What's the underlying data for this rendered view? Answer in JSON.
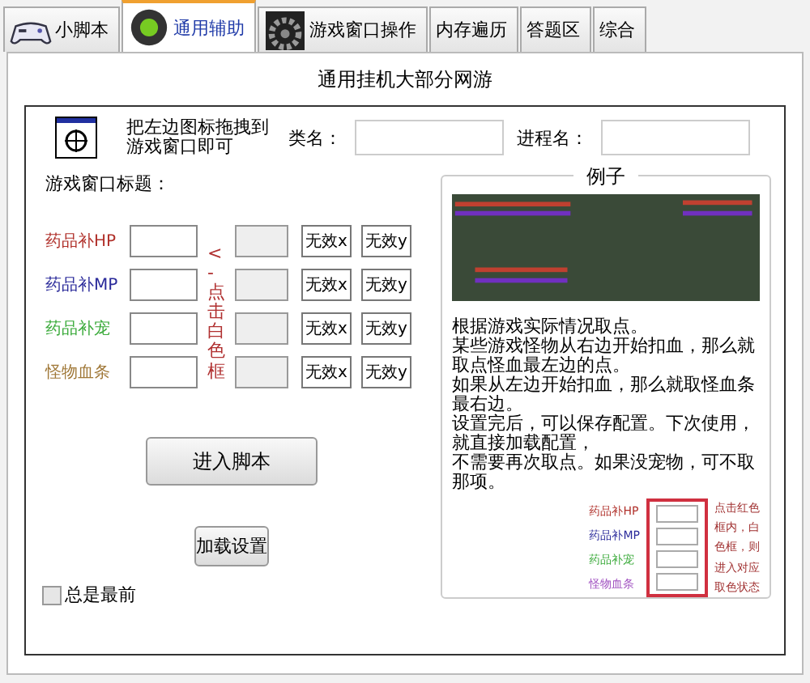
{
  "tabs": [
    {
      "label": "小脚本",
      "kind": "gamepad",
      "selected": false
    },
    {
      "label": "通用辅助",
      "kind": "orb",
      "selected": true
    },
    {
      "label": "游戏窗口操作",
      "kind": "gear",
      "selected": false
    },
    {
      "label": "内存遍历",
      "kind": "plain",
      "selected": false
    },
    {
      "label": "答题区",
      "kind": "plain",
      "selected": false
    },
    {
      "label": "综合",
      "kind": "plain",
      "selected": false
    }
  ],
  "panel_title": "通用挂机大部分网游",
  "drag_hint": "把左边图标拖拽到游戏窗口即可",
  "class_label": "类名：",
  "process_label": "进程名：",
  "window_title_label": "游戏窗口标题：",
  "rows": [
    {
      "label": "药品补HP",
      "color": "#b0302a",
      "x_button": "无效x",
      "y_button": "无效y"
    },
    {
      "label": "药品补MP",
      "color": "#2a2a9a",
      "x_button": "无效x",
      "y_button": "无效y"
    },
    {
      "label": "药品补宠",
      "color": "#3aaa3a",
      "x_button": "无效x",
      "y_button": "无效y"
    },
    {
      "label": "怪物血条",
      "color": "#a07838",
      "x_button": "无效x",
      "y_button": "无效y"
    }
  ],
  "side_note": "<-点击白色框",
  "enter_button": "进入脚本",
  "load_button": "加载设置",
  "always_on_top": {
    "label": "总是最前",
    "checked": false
  },
  "example": {
    "title": "例子",
    "lines": [
      "根据游戏实际情况取点。",
      "某些游戏怪物从右边开始扣血，那么就取点怪血最左边的点。",
      "如果从左边开始扣血，那么就取怪血条最右边。",
      "设置完后，可以保存配置。下次使用，就直接加载配置，",
      "不需要再次取点。如果没宠物，可不取那项。"
    ],
    "inset_rows": [
      {
        "label": "药品补HP",
        "color": "#b0302a"
      },
      {
        "label": "药品补MP",
        "color": "#2a2a9a"
      },
      {
        "label": "药品补宠",
        "color": "#3aaa3a"
      },
      {
        "label": "怪物血条",
        "color": "#a050c0"
      }
    ],
    "inset_note": [
      "点击红色",
      "框内，白",
      "色框，则",
      "进入对应",
      "取色状态"
    ]
  }
}
